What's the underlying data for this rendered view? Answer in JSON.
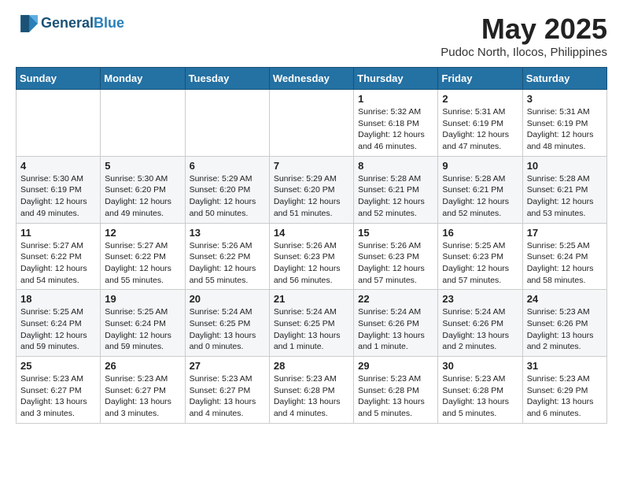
{
  "header": {
    "logo_line1": "General",
    "logo_line2": "Blue",
    "month": "May 2025",
    "location": "Pudoc North, Ilocos, Philippines"
  },
  "weekdays": [
    "Sunday",
    "Monday",
    "Tuesday",
    "Wednesday",
    "Thursday",
    "Friday",
    "Saturday"
  ],
  "weeks": [
    [
      {
        "day": "",
        "info": ""
      },
      {
        "day": "",
        "info": ""
      },
      {
        "day": "",
        "info": ""
      },
      {
        "day": "",
        "info": ""
      },
      {
        "day": "1",
        "info": "Sunrise: 5:32 AM\nSunset: 6:18 PM\nDaylight: 12 hours\nand 46 minutes."
      },
      {
        "day": "2",
        "info": "Sunrise: 5:31 AM\nSunset: 6:19 PM\nDaylight: 12 hours\nand 47 minutes."
      },
      {
        "day": "3",
        "info": "Sunrise: 5:31 AM\nSunset: 6:19 PM\nDaylight: 12 hours\nand 48 minutes."
      }
    ],
    [
      {
        "day": "4",
        "info": "Sunrise: 5:30 AM\nSunset: 6:19 PM\nDaylight: 12 hours\nand 49 minutes."
      },
      {
        "day": "5",
        "info": "Sunrise: 5:30 AM\nSunset: 6:20 PM\nDaylight: 12 hours\nand 49 minutes."
      },
      {
        "day": "6",
        "info": "Sunrise: 5:29 AM\nSunset: 6:20 PM\nDaylight: 12 hours\nand 50 minutes."
      },
      {
        "day": "7",
        "info": "Sunrise: 5:29 AM\nSunset: 6:20 PM\nDaylight: 12 hours\nand 51 minutes."
      },
      {
        "day": "8",
        "info": "Sunrise: 5:28 AM\nSunset: 6:21 PM\nDaylight: 12 hours\nand 52 minutes."
      },
      {
        "day": "9",
        "info": "Sunrise: 5:28 AM\nSunset: 6:21 PM\nDaylight: 12 hours\nand 52 minutes."
      },
      {
        "day": "10",
        "info": "Sunrise: 5:28 AM\nSunset: 6:21 PM\nDaylight: 12 hours\nand 53 minutes."
      }
    ],
    [
      {
        "day": "11",
        "info": "Sunrise: 5:27 AM\nSunset: 6:22 PM\nDaylight: 12 hours\nand 54 minutes."
      },
      {
        "day": "12",
        "info": "Sunrise: 5:27 AM\nSunset: 6:22 PM\nDaylight: 12 hours\nand 55 minutes."
      },
      {
        "day": "13",
        "info": "Sunrise: 5:26 AM\nSunset: 6:22 PM\nDaylight: 12 hours\nand 55 minutes."
      },
      {
        "day": "14",
        "info": "Sunrise: 5:26 AM\nSunset: 6:23 PM\nDaylight: 12 hours\nand 56 minutes."
      },
      {
        "day": "15",
        "info": "Sunrise: 5:26 AM\nSunset: 6:23 PM\nDaylight: 12 hours\nand 57 minutes."
      },
      {
        "day": "16",
        "info": "Sunrise: 5:25 AM\nSunset: 6:23 PM\nDaylight: 12 hours\nand 57 minutes."
      },
      {
        "day": "17",
        "info": "Sunrise: 5:25 AM\nSunset: 6:24 PM\nDaylight: 12 hours\nand 58 minutes."
      }
    ],
    [
      {
        "day": "18",
        "info": "Sunrise: 5:25 AM\nSunset: 6:24 PM\nDaylight: 12 hours\nand 59 minutes."
      },
      {
        "day": "19",
        "info": "Sunrise: 5:25 AM\nSunset: 6:24 PM\nDaylight: 12 hours\nand 59 minutes."
      },
      {
        "day": "20",
        "info": "Sunrise: 5:24 AM\nSunset: 6:25 PM\nDaylight: 13 hours\nand 0 minutes."
      },
      {
        "day": "21",
        "info": "Sunrise: 5:24 AM\nSunset: 6:25 PM\nDaylight: 13 hours\nand 1 minute."
      },
      {
        "day": "22",
        "info": "Sunrise: 5:24 AM\nSunset: 6:26 PM\nDaylight: 13 hours\nand 1 minute."
      },
      {
        "day": "23",
        "info": "Sunrise: 5:24 AM\nSunset: 6:26 PM\nDaylight: 13 hours\nand 2 minutes."
      },
      {
        "day": "24",
        "info": "Sunrise: 5:23 AM\nSunset: 6:26 PM\nDaylight: 13 hours\nand 2 minutes."
      }
    ],
    [
      {
        "day": "25",
        "info": "Sunrise: 5:23 AM\nSunset: 6:27 PM\nDaylight: 13 hours\nand 3 minutes."
      },
      {
        "day": "26",
        "info": "Sunrise: 5:23 AM\nSunset: 6:27 PM\nDaylight: 13 hours\nand 3 minutes."
      },
      {
        "day": "27",
        "info": "Sunrise: 5:23 AM\nSunset: 6:27 PM\nDaylight: 13 hours\nand 4 minutes."
      },
      {
        "day": "28",
        "info": "Sunrise: 5:23 AM\nSunset: 6:28 PM\nDaylight: 13 hours\nand 4 minutes."
      },
      {
        "day": "29",
        "info": "Sunrise: 5:23 AM\nSunset: 6:28 PM\nDaylight: 13 hours\nand 5 minutes."
      },
      {
        "day": "30",
        "info": "Sunrise: 5:23 AM\nSunset: 6:28 PM\nDaylight: 13 hours\nand 5 minutes."
      },
      {
        "day": "31",
        "info": "Sunrise: 5:23 AM\nSunset: 6:29 PM\nDaylight: 13 hours\nand 6 minutes."
      }
    ]
  ]
}
